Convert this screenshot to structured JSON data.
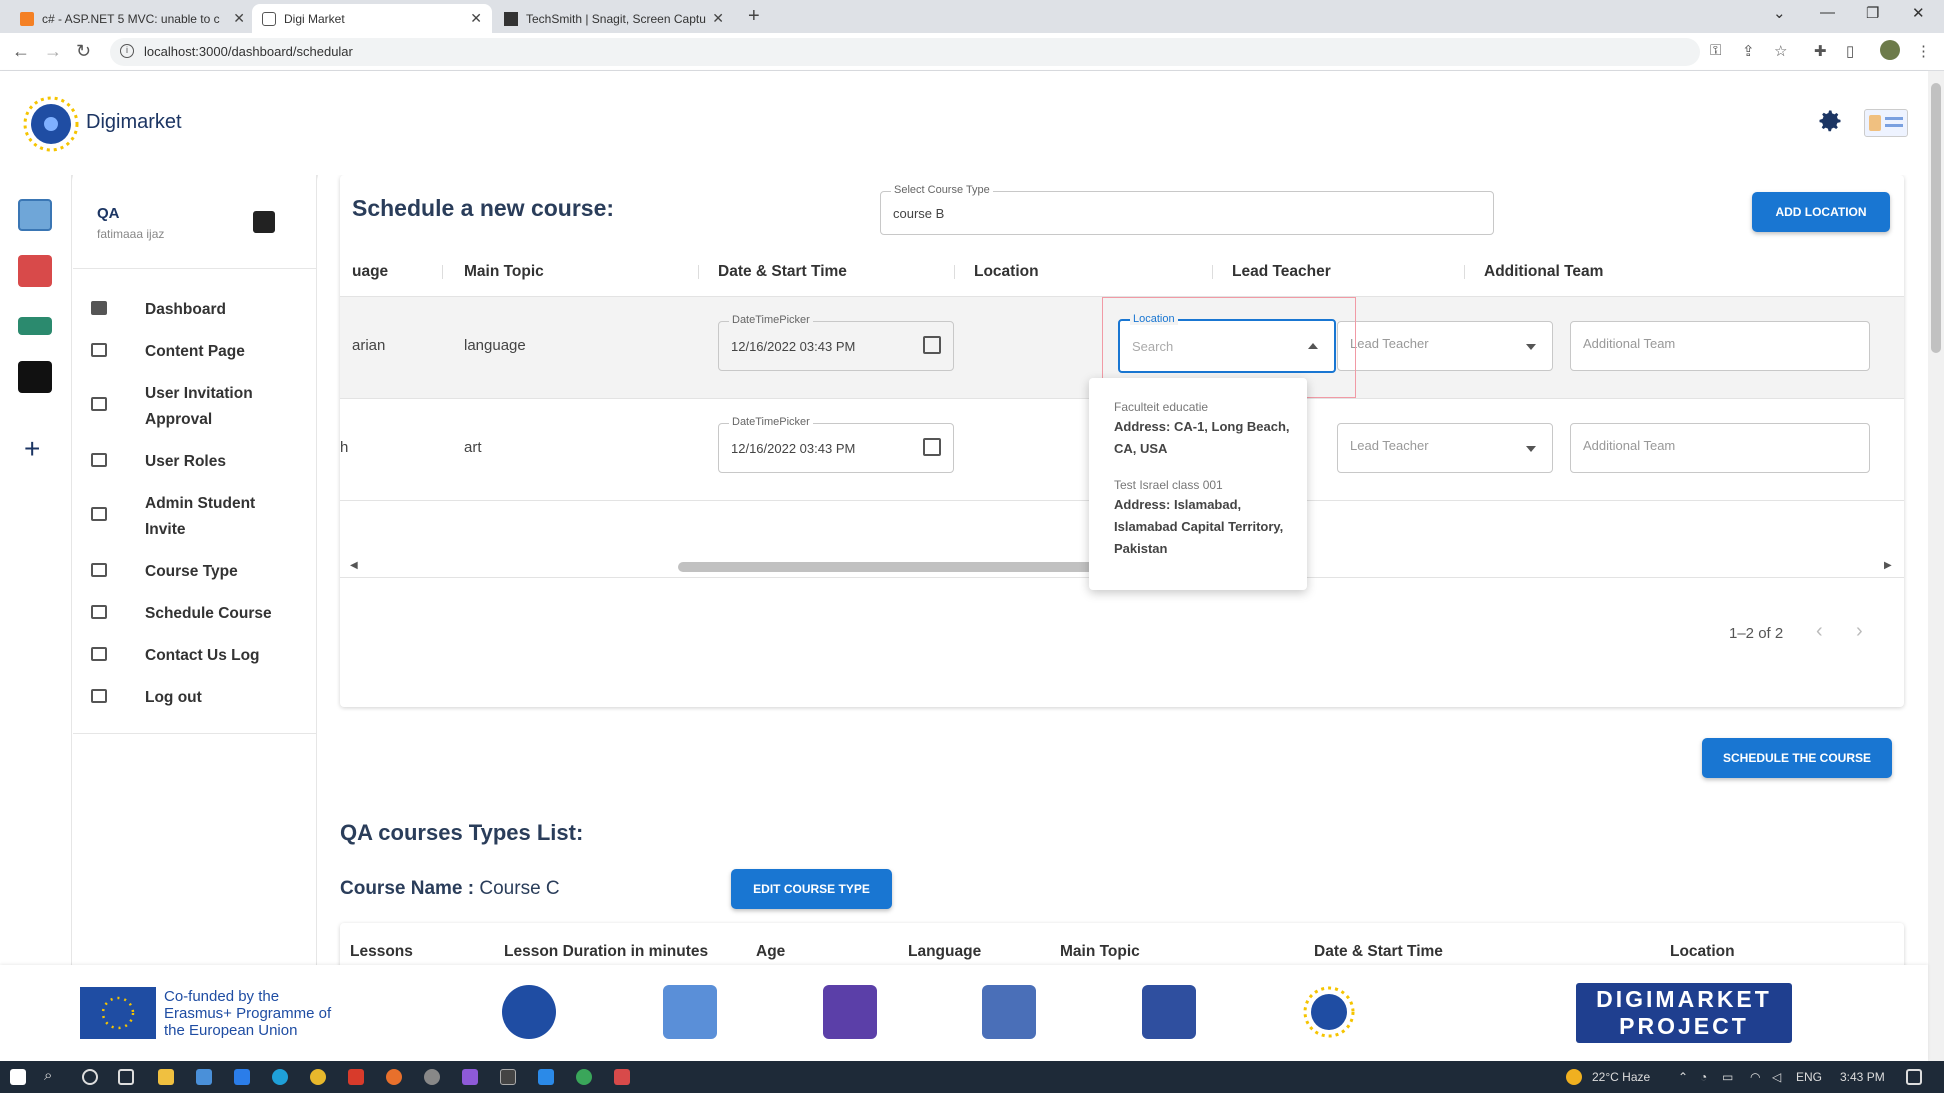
{
  "browser": {
    "tabs": [
      {
        "title": "c# - ASP.NET 5 MVC: unable to c"
      },
      {
        "title": "Digi Market"
      },
      {
        "title": "TechSmith | Snagit, Screen Captu"
      }
    ],
    "url": "localhost:3000/dashboard/schedular"
  },
  "header": {
    "brand": "Digimarket"
  },
  "sidebar": {
    "user_name": "QA",
    "user_email": "fatimaaa ijaz",
    "items": [
      {
        "label": "Dashboard"
      },
      {
        "label": "Content Page"
      },
      {
        "label": "User Invitation Approval"
      },
      {
        "label": "User Roles"
      },
      {
        "label": "Admin Student Invite"
      },
      {
        "label": "Course Type"
      },
      {
        "label": "Schedule Course"
      },
      {
        "label": "Contact Us Log"
      },
      {
        "label": "Log out"
      }
    ]
  },
  "schedule": {
    "title": "Schedule a new course:",
    "course_type_label": "Select Course Type",
    "course_type_value": "course B",
    "add_location": "ADD LOCATION",
    "columns": [
      "uage",
      "Main Topic",
      "Date & Start Time",
      "Location",
      "Lead Teacher",
      "Additional Team"
    ],
    "rows": [
      {
        "language": "arian",
        "topic": "language",
        "date_label": "DateTimePicker",
        "date": "12/16/2022 03:43 PM",
        "location_label": "Location",
        "location_placeholder": "Search",
        "lead_placeholder": "Lead Teacher",
        "team_placeholder": "Additional Team"
      },
      {
        "language": "h",
        "topic": "art",
        "date_label": "DateTimePicker",
        "date": "12/16/2022 03:43 PM",
        "lead_placeholder": "Lead Teacher",
        "team_placeholder": "Additional Team"
      }
    ],
    "location_options": [
      {
        "name": "Faculteit educatie",
        "address": "Address: CA-1, Long Beach, CA, USA"
      },
      {
        "name": "Test Israel class 001",
        "address": "Address: Islamabad, Islamabad Capital Territory, Pakistan"
      }
    ],
    "pagination": "1–2 of 2",
    "schedule_button": "SCHEDULE THE COURSE"
  },
  "types_list": {
    "title": "QA courses Types List:",
    "course_name_label": "Course Name :",
    "course_name_value": "Course C",
    "edit_button": "EDIT COURSE TYPE",
    "columns": [
      "Lessons",
      "Lesson Duration in minutes",
      "Age",
      "Language",
      "Main Topic",
      "Date & Start Time",
      "Location"
    ]
  },
  "footer": {
    "eu_text": "Co-funded by the Erasmus+ Programme of the European Union",
    "banner_line1": "DIGIMARKET",
    "banner_line2": "PROJECT"
  },
  "taskbar": {
    "weather": "22°C Haze",
    "lang": "ENG",
    "time": "3:43 PM"
  },
  "colors": {
    "primary": "#1976d2",
    "heading": "#2a3d5a",
    "brand": "#1c3563",
    "eu_blue": "#1f4da3"
  }
}
